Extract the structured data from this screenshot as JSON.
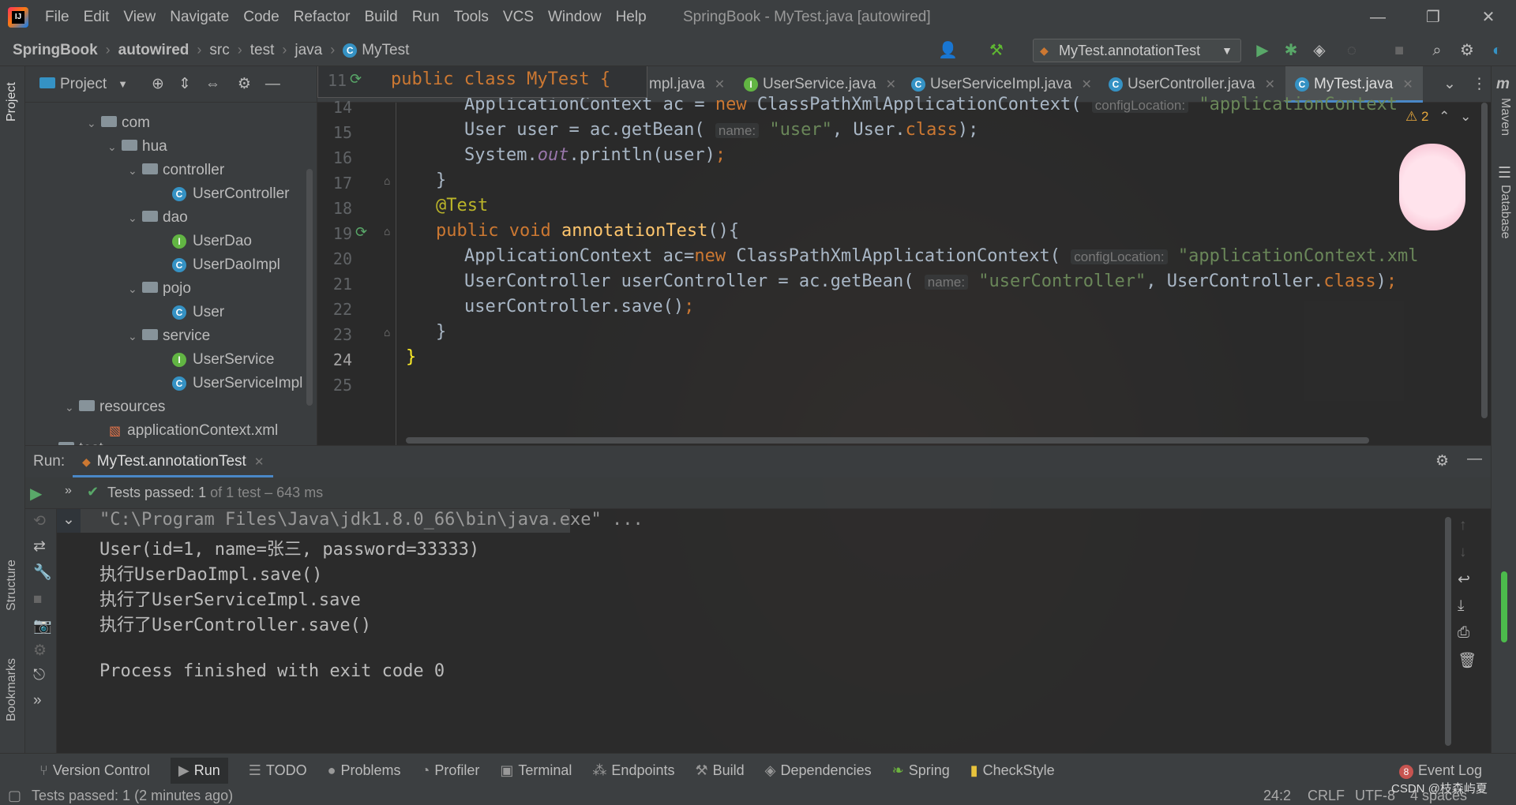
{
  "menu": {
    "items": [
      "File",
      "Edit",
      "View",
      "Navigate",
      "Code",
      "Refactor",
      "Build",
      "Run",
      "Tools",
      "VCS",
      "Window",
      "Help"
    ],
    "window_title": "SpringBook - MyTest.java [autowired]"
  },
  "breadcrumb": [
    "SpringBook",
    "autowired",
    "src",
    "test",
    "java",
    "MyTest"
  ],
  "run_config": "MyTest.annotationTest",
  "project": {
    "title": "Project",
    "tree": [
      {
        "label": "com",
        "type": "package"
      },
      {
        "label": "hua",
        "type": "package"
      },
      {
        "label": "controller",
        "type": "package"
      },
      {
        "label": "UserController",
        "type": "class"
      },
      {
        "label": "dao",
        "type": "package"
      },
      {
        "label": "UserDao",
        "type": "interface"
      },
      {
        "label": "UserDaoImpl",
        "type": "class"
      },
      {
        "label": "pojo",
        "type": "package"
      },
      {
        "label": "User",
        "type": "class"
      },
      {
        "label": "service",
        "type": "package"
      },
      {
        "label": "UserService",
        "type": "interface"
      },
      {
        "label": "UserServiceImpl",
        "type": "class"
      },
      {
        "label": "resources",
        "type": "folder"
      },
      {
        "label": "applicationContext.xml",
        "type": "xml"
      },
      {
        "label": "test",
        "type": "folder"
      }
    ]
  },
  "tabs": [
    "mpl.java",
    "UserService.java",
    "UserServiceImpl.java",
    "UserController.java",
    "MyTest.java"
  ],
  "editor": {
    "sticky_line_number": "11",
    "sticky_code": "public class MyTest {",
    "warning_count": "2",
    "line_numbers": [
      "14",
      "15",
      "16",
      "17",
      "18",
      "19",
      "20",
      "21",
      "22",
      "23",
      "24",
      "25"
    ],
    "hints": {
      "configLocation": "configLocation:",
      "name": "name:"
    },
    "strings": {
      "line14_tail": "\"applicationContext",
      "user": "\"user\"",
      "appctx": "\"applicationContext.xml",
      "userController": "\"userController\""
    }
  },
  "run": {
    "label": "Run:",
    "tab": "MyTest.annotationTest",
    "tests_passed": "Tests passed:",
    "tests_count": "1",
    "tests_detail": "of 1 test – 643 ms",
    "output": [
      "\"C:\\Program Files\\Java\\jdk1.8.0_66\\bin\\java.exe\" ...",
      "User(id=1, name=张三, password=33333)",
      "执行UserDaoImpl.save()",
      "执行了UserServiceImpl.save",
      "执行了UserController.save()",
      "",
      "Process finished with exit code 0"
    ]
  },
  "tool_windows": [
    "Version Control",
    "Run",
    "TODO",
    "Problems",
    "Profiler",
    "Terminal",
    "Endpoints",
    "Build",
    "Dependencies",
    "Spring",
    "CheckStyle"
  ],
  "event_log": {
    "label": "Event Log",
    "count": "8"
  },
  "left_stripe": [
    "Project",
    "Structure",
    "Bookmarks"
  ],
  "right_stripe": [
    "Maven",
    "Database"
  ],
  "status": {
    "message": "Tests passed: 1 (2 minutes ago)",
    "position": "24:2",
    "line_sep": "CRLF",
    "encoding": "UTF-8",
    "indent": "4 spaces",
    "watermark": "CSDN @枝森屿夏"
  }
}
